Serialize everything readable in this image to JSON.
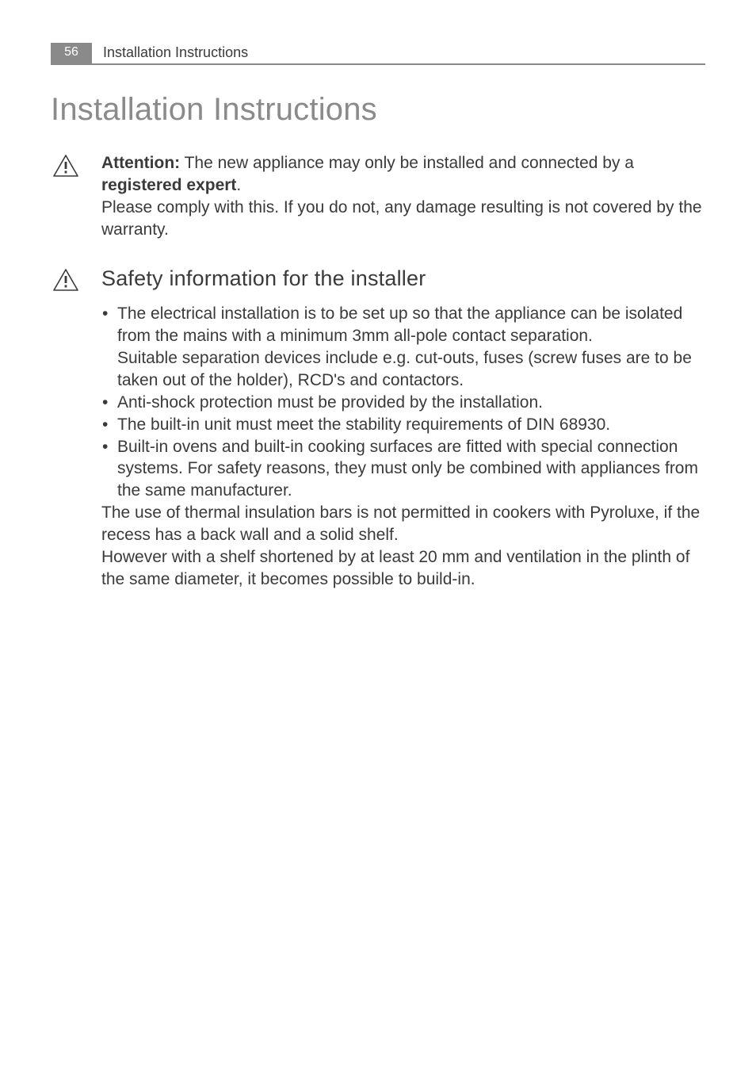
{
  "header": {
    "page_number": "56",
    "running_title": "Installation Instructions"
  },
  "title": "Installation Instructions",
  "attention": {
    "label": "Attention:",
    "text_1_before": " The new appliance may only be installed and connected by a ",
    "bold_phrase": "registered expert",
    "text_1_after": ".",
    "text_2": "Please comply with this. If you do not, any damage resulting is not covered by the warranty."
  },
  "safety_heading": "Safety information for the installer",
  "bullets": [
    "The electrical installation is to be set up so that the appliance can be isolated from the mains with a minimum 3mm all-pole contact separation.\nSuitable separation devices include e.g. cut-outs, fuses (screw fuses are to be taken out of the holder), RCD's and contactors.",
    "Anti-shock protection must be provided by the installation.",
    "The built-in unit must meet the stability requirements of DIN 68930.",
    "Built-in ovens and built-in cooking surfaces are fitted with special connection systems. For safety reasons, they must only be combined with appliances from the same manufacturer."
  ],
  "trailing": [
    "The use of thermal insulation bars is not permitted in cookers with Pyroluxe, if the recess has a back wall and a solid shelf.",
    "However with a shelf shortened by at least 20 mm and ventilation in the plinth of the same diameter, it becomes possible to build-in."
  ],
  "icons": {
    "warning": "warning-triangle-icon"
  }
}
